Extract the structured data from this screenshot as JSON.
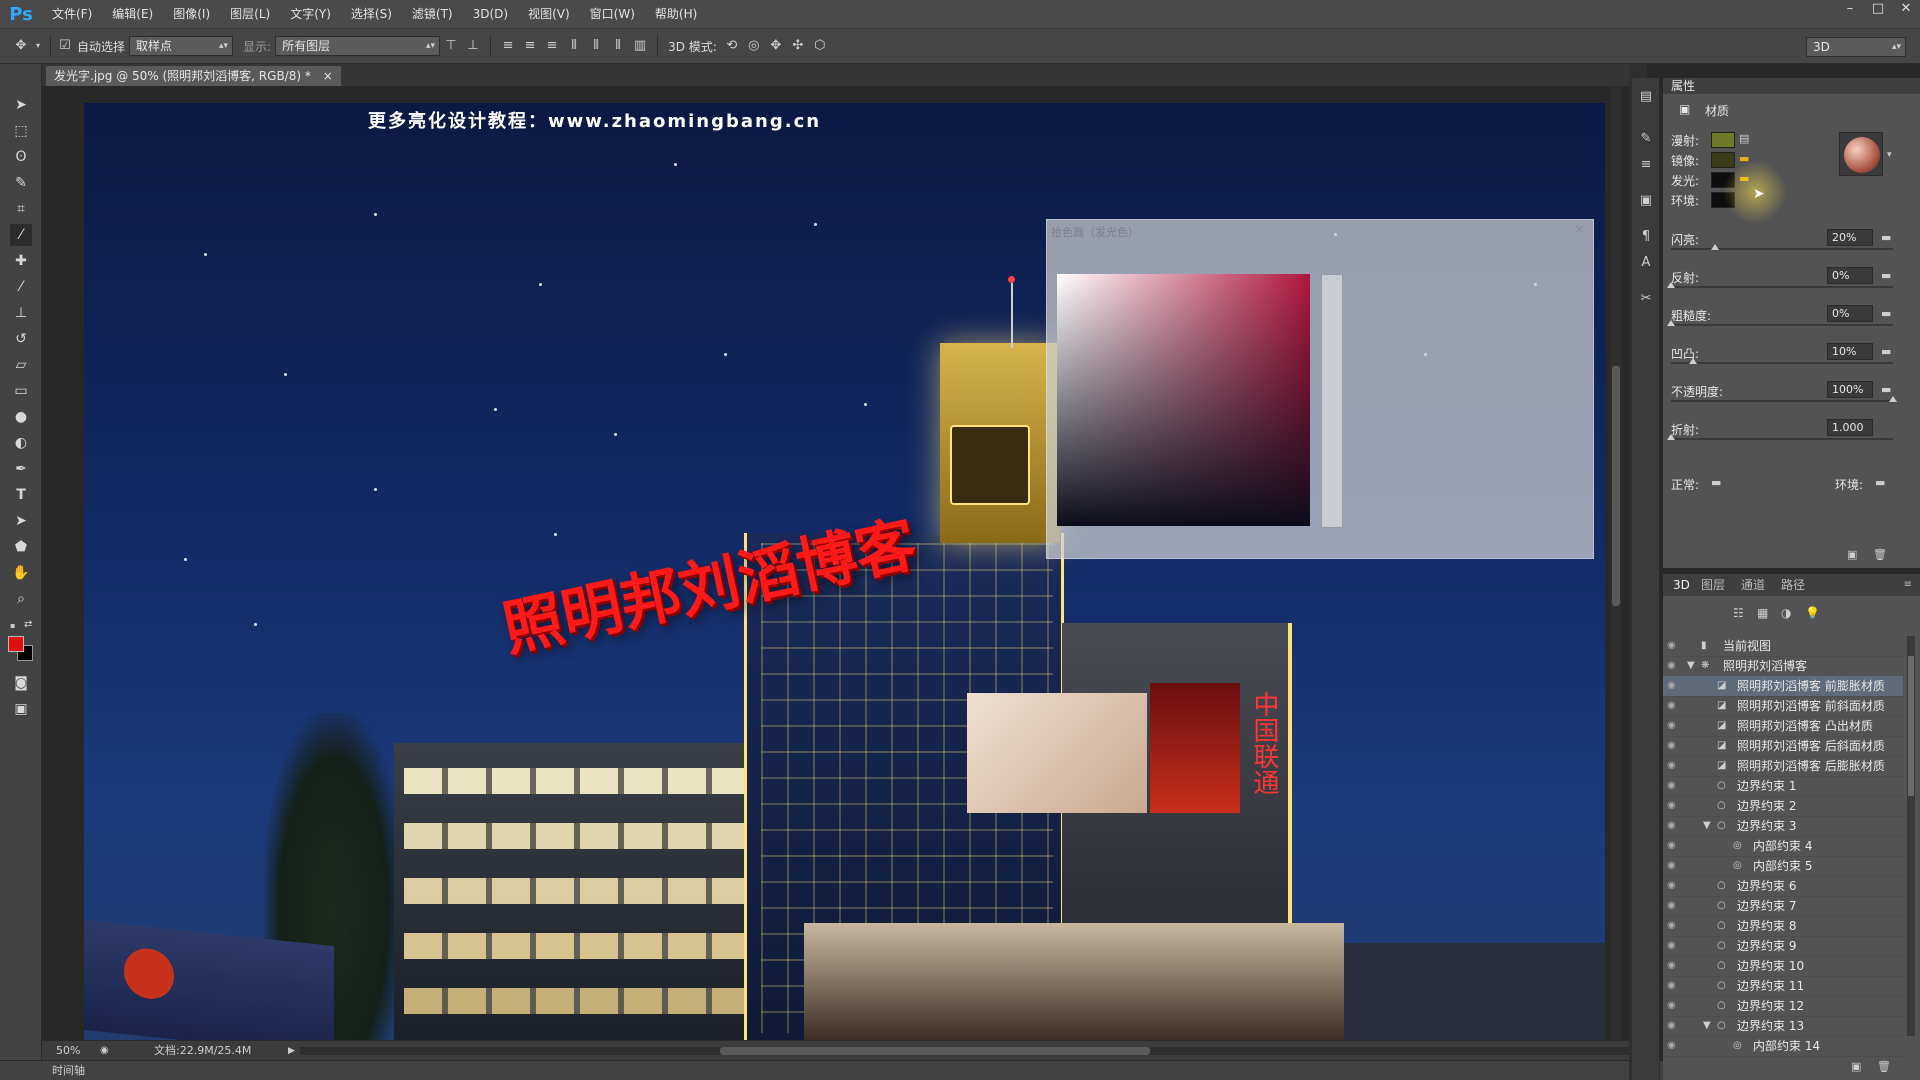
{
  "app": {
    "logo": "Ps"
  },
  "menu": [
    "文件(F)",
    "编辑(E)",
    "图像(I)",
    "图层(L)",
    "文字(Y)",
    "选择(S)",
    "滤镜(T)",
    "3D(D)",
    "视图(V)",
    "窗口(W)",
    "帮助(H)"
  ],
  "options": {
    "auto_select_label": "自动选择",
    "auto_select_value": "取样点",
    "show_label": "显示:",
    "show_value": "所有图层",
    "mode3d_label": "3D 模式:",
    "workspace_value": "3D"
  },
  "document": {
    "tab_title": "发光字.jpg @ 50% (照明邦刘滔博客, RGB/8) *",
    "close_glyph": "×",
    "watermark": "更多亮化设计教程：www.zhaomingbang.cn",
    "sign_text": "照明邦刘滔博客"
  },
  "picker": {
    "title": "拾色器（发光色）",
    "close": "×"
  },
  "status": {
    "zoom": "50%",
    "doc_info": "文档:22.9M/25.4M"
  },
  "timeline": {
    "label": "时间轴"
  },
  "properties": {
    "tab": "属性",
    "type_label": "材质",
    "swatches": [
      {
        "label": "漫射:",
        "color": "#6e7a2a"
      },
      {
        "label": "镜像:",
        "color": "#3b3b1a"
      },
      {
        "label": "发光:",
        "color": "#0d0d0d"
      },
      {
        "label": "环境:",
        "color": "#0d0d0d"
      }
    ],
    "sliders": [
      {
        "label": "闪亮:",
        "value": "20%",
        "level": 0.2
      },
      {
        "label": "反射:",
        "value": "0%",
        "level": 0
      },
      {
        "label": "粗糙度:",
        "value": "0%",
        "level": 0
      },
      {
        "label": "凹凸:",
        "value": "10%",
        "level": 0.1
      },
      {
        "label": "不透明度:",
        "value": "100%",
        "level": 1
      },
      {
        "label": "折射:",
        "value": "1.000",
        "level": 0
      }
    ],
    "normal_label": "正常:",
    "env_label": "环境:"
  },
  "panel3d": {
    "tabs": [
      "3D",
      "图层",
      "通道",
      "路径"
    ],
    "rows": [
      {
        "label": "当前视图",
        "indent": 1
      },
      {
        "label": "照明邦刘滔博客",
        "indent": 1,
        "expanded": true
      },
      {
        "label": "照明邦刘滔博客 前膨胀材质",
        "indent": 2,
        "selected": true
      },
      {
        "label": "照明邦刘滔博客 前斜面材质",
        "indent": 2
      },
      {
        "label": "照明邦刘滔博客 凸出材质",
        "indent": 2
      },
      {
        "label": "照明邦刘滔博客 后斜面材质",
        "indent": 2
      },
      {
        "label": "照明邦刘滔博客 后膨胀材质",
        "indent": 2
      },
      {
        "label": "边界约束 1",
        "indent": 2
      },
      {
        "label": "边界约束 2",
        "indent": 2
      },
      {
        "label": "边界约束 3",
        "indent": 2,
        "expanded": true
      },
      {
        "label": "内部约束 4",
        "indent": 3
      },
      {
        "label": "内部约束 5",
        "indent": 3
      },
      {
        "label": "边界约束 6",
        "indent": 2
      },
      {
        "label": "边界约束 7",
        "indent": 2
      },
      {
        "label": "边界约束 8",
        "indent": 2
      },
      {
        "label": "边界约束 9",
        "indent": 2
      },
      {
        "label": "边界约束 10",
        "indent": 2
      },
      {
        "label": "边界约束 11",
        "indent": 2
      },
      {
        "label": "边界约束 12",
        "indent": 2
      },
      {
        "label": "边界约束 13",
        "indent": 2,
        "expanded": true
      },
      {
        "label": "内部约束 14",
        "indent": 3
      }
    ]
  },
  "colors": {
    "foreground": "#e01010",
    "background": "#000000",
    "accent_selection": "#5f6a7a"
  }
}
